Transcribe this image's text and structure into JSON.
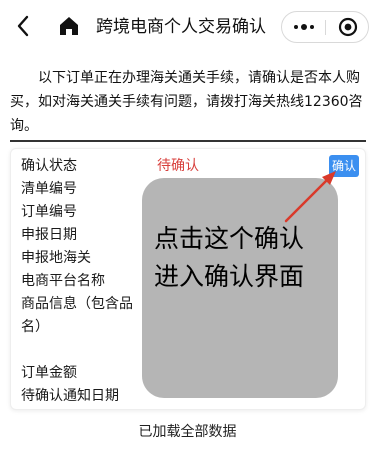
{
  "navbar": {
    "title": "跨境电商个人交易确认",
    "back_icon": "chevron-left-icon",
    "home_icon": "home-icon",
    "more_icon": "more-dots-icon",
    "close_icon": "target-close-icon"
  },
  "notice": {
    "text": "以下订单正在办理海关通关手续，请确认是否本人购买，如对海关通关手续有问题，请拨打海关热线12360咨询。"
  },
  "card": {
    "labels": {
      "status": "确认状态",
      "list_no": "清单编号",
      "order_no": "订单编号",
      "declare_date": "申报日期",
      "declare_customs": "申报地海关",
      "platform_name": "电商平台名称",
      "goods_info_1": "商品信息（包含品",
      "goods_info_2": "名）",
      "order_amount": "订单金额",
      "notify_date": "待确认通知日期"
    },
    "status_value": "待确认",
    "confirm_button": "确认",
    "status_color": "#d8403d",
    "button_color": "#3b8ff0"
  },
  "overlay": {
    "line1": "点击这个确认",
    "line2": "进入确认界面"
  },
  "footer": {
    "text": "已加载全部数据"
  }
}
